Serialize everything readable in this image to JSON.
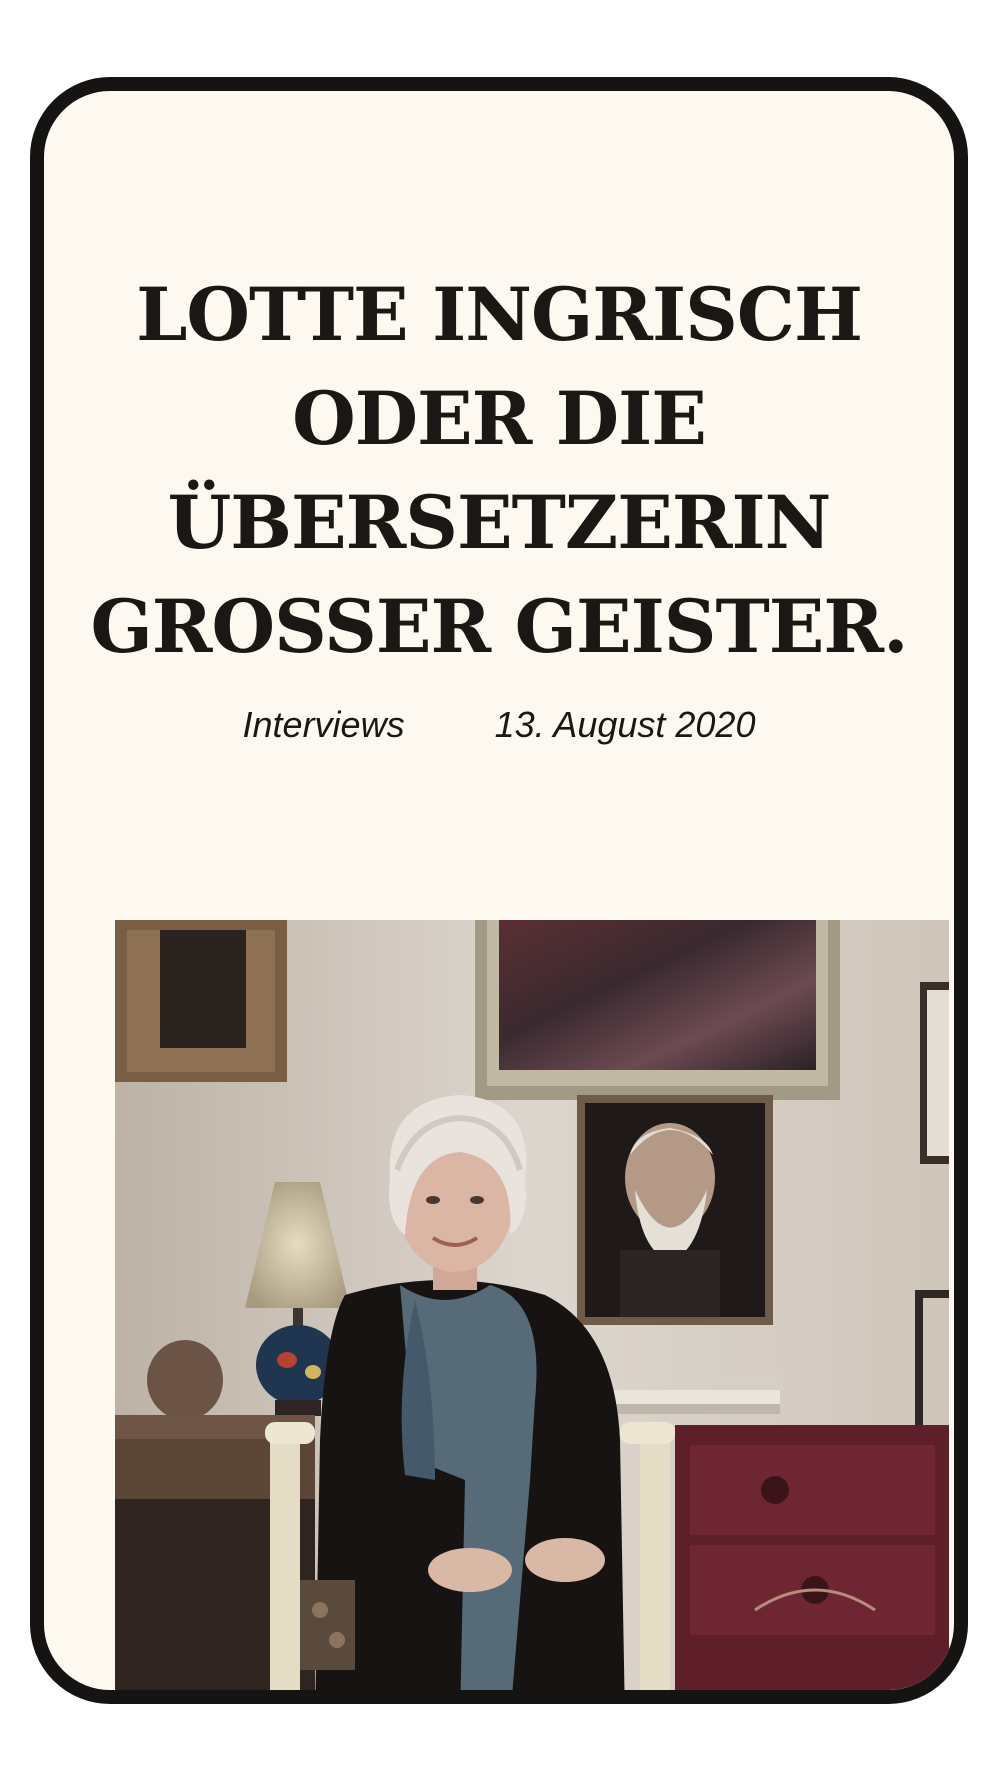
{
  "article": {
    "title_lines": [
      "LOTTE INGRISCH",
      "ODER DIE",
      "ÜBERSETZERIN",
      "GROSSER GEISTER."
    ],
    "category": "Interviews",
    "date": "13. August 2020"
  },
  "colors": {
    "page_background": "#fdf9f1",
    "text": "#1a1714",
    "frame": "#161413"
  }
}
